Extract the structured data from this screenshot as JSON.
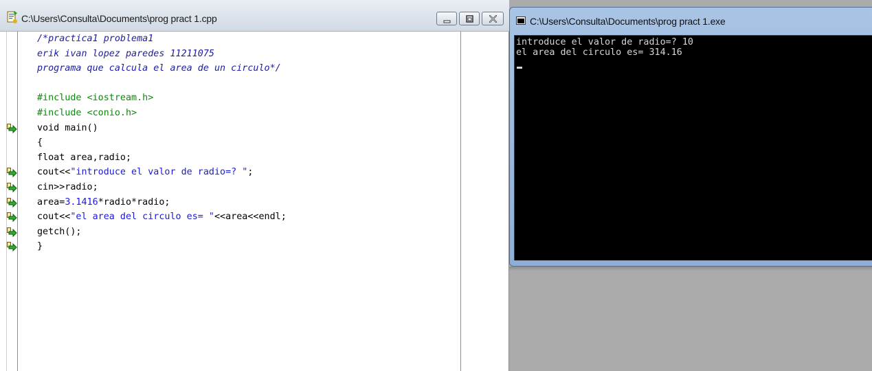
{
  "editor": {
    "title": "C:\\Users\\Consulta\\Documents\\prog pract 1.cpp",
    "buttons": {
      "minimize": "minimize-icon",
      "maximize": "maximize-icon",
      "close": "close-icon"
    },
    "code_lines": [
      {
        "parts": [
          {
            "t": "/*practica1 problema1",
            "k": "comment"
          }
        ]
      },
      {
        "parts": [
          {
            "t": "erik ivan lopez paredes 11211075",
            "k": "comment"
          }
        ]
      },
      {
        "parts": [
          {
            "t": "programa que calcula el area de un circulo*/",
            "k": "comment"
          }
        ]
      },
      {
        "parts": []
      },
      {
        "parts": [
          {
            "t": "#include ",
            "k": "pre"
          },
          {
            "t": "<iostream.h>",
            "k": "pre"
          }
        ]
      },
      {
        "parts": [
          {
            "t": "#include ",
            "k": "pre"
          },
          {
            "t": "<conio.h>",
            "k": "pre"
          }
        ]
      },
      {
        "parts": [
          {
            "t": "void main()",
            "k": "plain"
          }
        ],
        "bp": true
      },
      {
        "parts": [
          {
            "t": "{",
            "k": "plain"
          }
        ]
      },
      {
        "parts": [
          {
            "t": "float area,radio;",
            "k": "plain"
          }
        ]
      },
      {
        "parts": [
          {
            "t": "cout<<",
            "k": "plain"
          },
          {
            "t": "\"introduce el valor de radio=? \"",
            "k": "str"
          },
          {
            "t": ";",
            "k": "plain"
          }
        ],
        "bp": true
      },
      {
        "parts": [
          {
            "t": "cin>>radio;",
            "k": "plain"
          }
        ],
        "bp": true
      },
      {
        "parts": [
          {
            "t": "area=",
            "k": "plain"
          },
          {
            "t": "3.1416",
            "k": "num"
          },
          {
            "t": "*radio*radio;",
            "k": "plain"
          }
        ],
        "bp": true
      },
      {
        "parts": [
          {
            "t": "cout<<",
            "k": "plain"
          },
          {
            "t": "\"el area del circulo es= \"",
            "k": "str"
          },
          {
            "t": "<<area<<endl;",
            "k": "plain"
          }
        ],
        "bp": true
      },
      {
        "parts": [
          {
            "t": "getch();",
            "k": "plain"
          }
        ],
        "bp": true
      },
      {
        "parts": [
          {
            "t": "}",
            "k": "plain"
          }
        ],
        "bp": true
      }
    ]
  },
  "console": {
    "title": "C:\\Users\\Consulta\\Documents\\prog pract 1.exe",
    "output": [
      "introduce el valor de radio=? 10",
      "el area del circulo es= 314.16"
    ]
  },
  "colors": {
    "comment": "#1c1c9e",
    "preprocessor": "#0a8a0a",
    "string": "#1a1ad8",
    "console_bg": "#000000",
    "console_text": "#d6d6d6"
  }
}
